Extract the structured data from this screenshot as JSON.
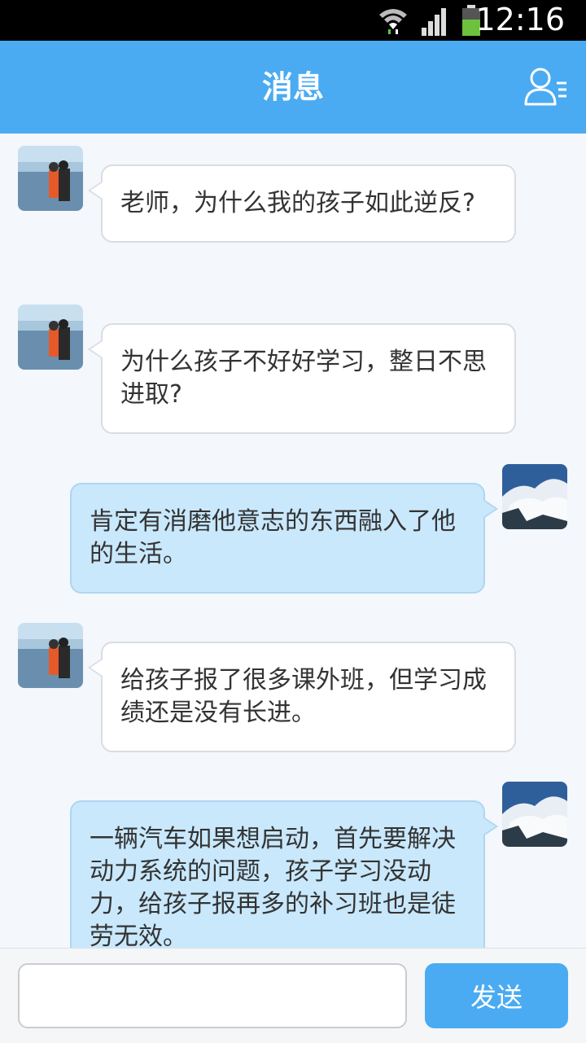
{
  "status_bar": {
    "time": "12:16"
  },
  "header": {
    "title": "消息",
    "contacts_icon": "contacts-icon"
  },
  "messages": [
    {
      "side": "in",
      "text": "老师，为什么我的孩子如此逆反?"
    },
    {
      "side": "in",
      "text": "为什么孩子不好好学习，整日不思进取?"
    },
    {
      "side": "out",
      "text": "肯定有消磨他意志的东西融入了他的生活。"
    },
    {
      "side": "in",
      "text": "给孩子报了很多课外班，但学习成绩还是没有长进。"
    },
    {
      "side": "out",
      "text": "一辆汽车如果想启动，首先要解决动力系统的问题，孩子学习没动力，给孩子报再多的补习班也是徒劳无效。"
    }
  ],
  "input": {
    "value": "",
    "placeholder": ""
  },
  "send_button": {
    "label": "发送"
  },
  "colors": {
    "accent": "#4aabf2",
    "bubble_out": "#c9e8fc",
    "bubble_in": "#ffffff"
  }
}
